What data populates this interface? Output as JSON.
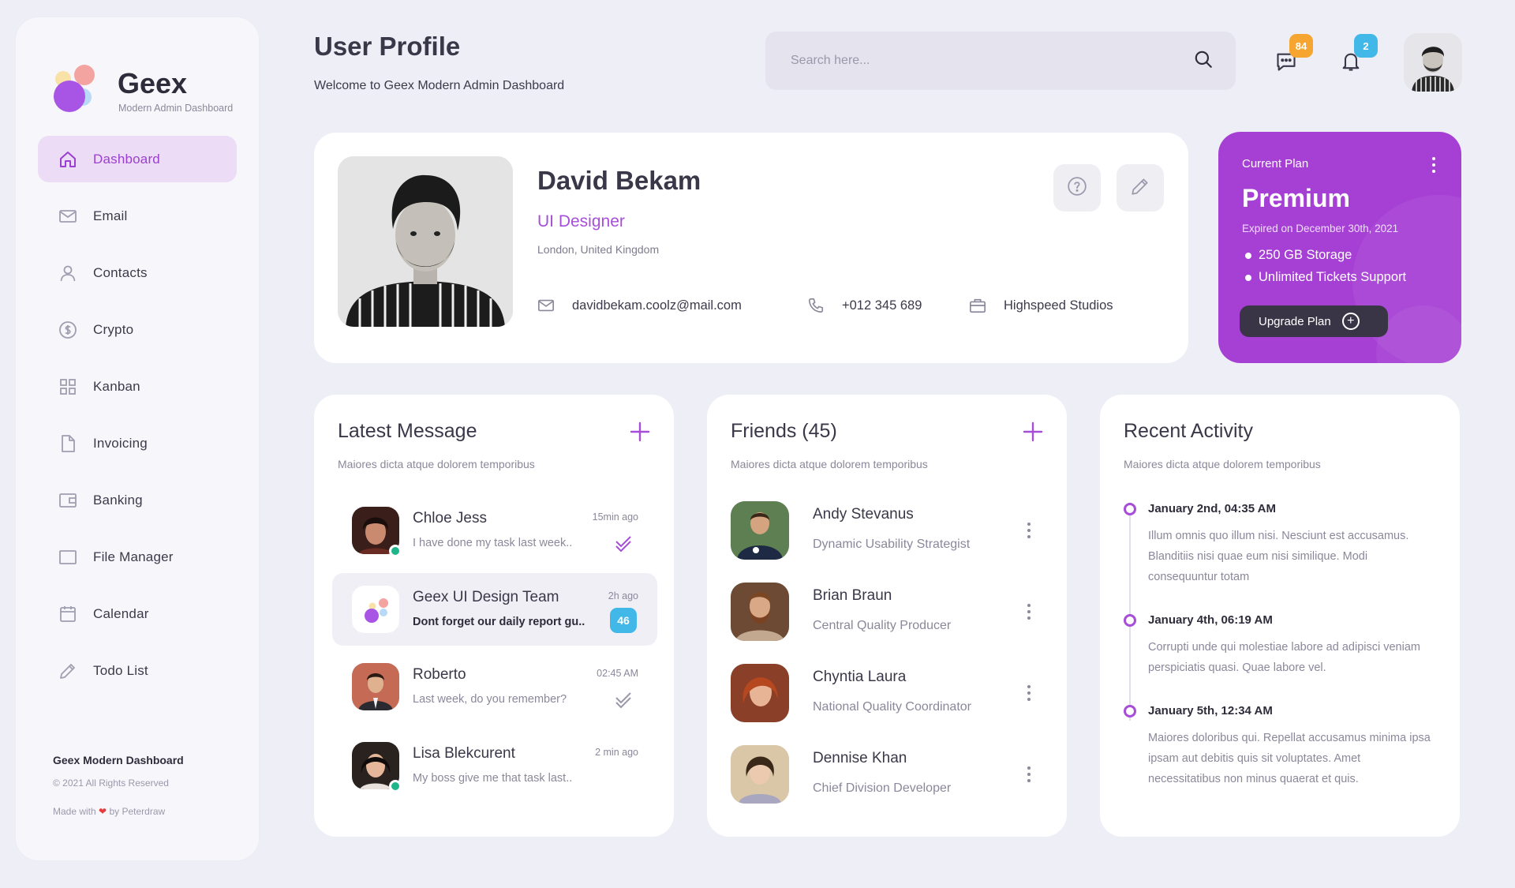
{
  "brand": {
    "name": "Geex",
    "subtitle": "Modern Admin Dashboard"
  },
  "sidebar": {
    "items": [
      {
        "label": "Dashboard",
        "icon": "home-icon",
        "active": true
      },
      {
        "label": "Email",
        "icon": "mail-icon"
      },
      {
        "label": "Contacts",
        "icon": "user-icon"
      },
      {
        "label": "Crypto",
        "icon": "dollar-coin-icon"
      },
      {
        "label": "Kanban",
        "icon": "grid-icon"
      },
      {
        "label": "Invoicing",
        "icon": "document-icon"
      },
      {
        "label": "Banking",
        "icon": "wallet-icon"
      },
      {
        "label": "File Manager",
        "icon": "folder-icon"
      },
      {
        "label": "Calendar",
        "icon": "calendar-icon"
      },
      {
        "label": "Todo List",
        "icon": "pencil-icon"
      }
    ],
    "footer": {
      "title": "Geex Modern Dashboard",
      "copyright": "© 2021 All Rights Reserved",
      "made_prefix": "Made with",
      "made_suffix": "by Peterdraw"
    }
  },
  "header": {
    "title": "User Profile",
    "subtitle": "Welcome to Geex Modern Admin Dashboard",
    "search_placeholder": "Search here...",
    "messages_badge": "84",
    "notifications_badge": "2"
  },
  "profile": {
    "name": "David Bekam",
    "role": "UI Designer",
    "location": "London, United Kingdom",
    "email": "davidbekam.coolz@mail.com",
    "phone": "+012 345 689",
    "company": "Highspeed Studios"
  },
  "plan": {
    "label": "Current Plan",
    "name": "Premium",
    "expires": "Expired on December 30th, 2021",
    "features": [
      "250 GB Storage",
      "Unlimited Tickets Support"
    ],
    "button": "Upgrade Plan"
  },
  "messages": {
    "title": "Latest Message",
    "description": "Maiores dicta atque dolorem temporibus",
    "items": [
      {
        "name": "Chloe Jess",
        "text": "I have done my task last week..",
        "time": "15min ago",
        "online": true,
        "status": "read"
      },
      {
        "name": "Geex UI Design Team",
        "text": "Dont forget our daily report gu..",
        "time": "2h ago",
        "count": "46",
        "active": true
      },
      {
        "name": "Roberto",
        "text": "Last week, do you remember?",
        "time": "02:45 AM",
        "status": "delivered"
      },
      {
        "name": "Lisa Blekcurent",
        "text": "My boss give me that task last..",
        "time": "2 min ago",
        "online": true
      }
    ]
  },
  "friends": {
    "title": "Friends (45)",
    "description": "Maiores dicta atque dolorem temporibus",
    "items": [
      {
        "name": "Andy Stevanus",
        "role": "Dynamic Usability Strategist"
      },
      {
        "name": "Brian Braun",
        "role": "Central Quality Producer"
      },
      {
        "name": "Chyntia Laura",
        "role": "National Quality Coordinator"
      },
      {
        "name": "Dennise Khan",
        "role": "Chief Division Developer"
      }
    ]
  },
  "activity": {
    "title": "Recent Activity",
    "description": "Maiores dicta atque dolorem temporibus",
    "items": [
      {
        "date": "January 2nd, 04:35 AM",
        "text": "Illum omnis quo illum nisi. Nesciunt est accusamus. Blanditiis nisi quae eum nisi similique. Modi consequuntur totam"
      },
      {
        "date": "January 4th, 06:19 AM",
        "text": "Corrupti unde qui molestiae labore ad adipisci veniam perspiciatis quasi. Quae labore vel."
      },
      {
        "date": "January 5th, 12:34 AM",
        "text": "Maiores doloribus qui. Repellat accusamus minima ipsa ipsam aut debitis quis sit voluptates. Amet necessitatibus non minus quaerat et quis."
      }
    ]
  },
  "colors": {
    "accent": "#a74ed9",
    "plan_bg": "#a63fd4",
    "online": "#1fb58a",
    "badge_orange": "#f7a531",
    "badge_blue": "#42b8e8"
  }
}
